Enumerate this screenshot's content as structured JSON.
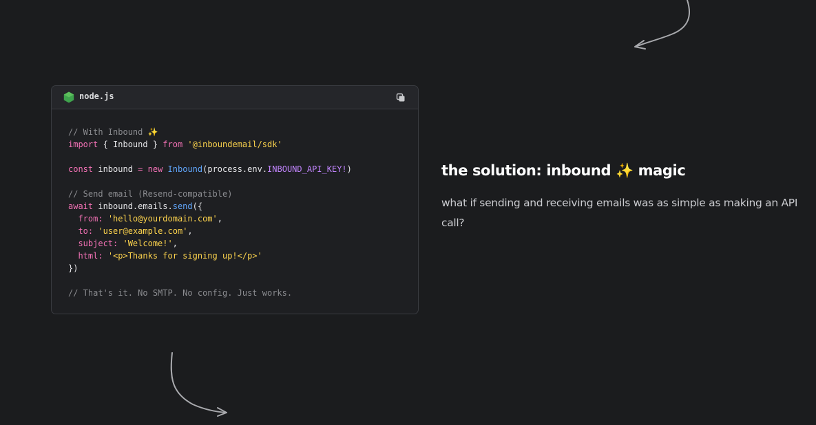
{
  "code_block": {
    "language_label": "node.js",
    "language_icon": "nodejs-hexagon-icon",
    "copy_icon": "copy-icon",
    "lines": [
      [
        {
          "c": "cm",
          "t": "// With Inbound ✨"
        }
      ],
      [
        {
          "c": "kw",
          "t": "import"
        },
        {
          "c": "pl",
          "t": " { Inbound } "
        },
        {
          "c": "kw",
          "t": "from"
        },
        {
          "c": "pl",
          "t": " "
        },
        {
          "c": "st",
          "t": "'@inboundemail/sdk'"
        }
      ],
      [],
      [
        {
          "c": "kw",
          "t": "const"
        },
        {
          "c": "pl",
          "t": " inbound "
        },
        {
          "c": "kw",
          "t": "="
        },
        {
          "c": "pl",
          "t": " "
        },
        {
          "c": "kw",
          "t": "new"
        },
        {
          "c": "pl",
          "t": " "
        },
        {
          "c": "cls",
          "t": "Inbound"
        },
        {
          "c": "pl",
          "t": "(process.env."
        },
        {
          "c": "cn",
          "t": "INBOUND_API_KEY!"
        },
        {
          "c": "pl",
          "t": ")"
        }
      ],
      [],
      [
        {
          "c": "cm",
          "t": "// Send email (Resend-compatible)"
        }
      ],
      [
        {
          "c": "kw",
          "t": "await"
        },
        {
          "c": "pl",
          "t": " inbound.emails."
        },
        {
          "c": "cls",
          "t": "send"
        },
        {
          "c": "pl",
          "t": "({"
        }
      ],
      [
        {
          "c": "pl",
          "t": "  "
        },
        {
          "c": "pr",
          "t": "from:"
        },
        {
          "c": "pl",
          "t": " "
        },
        {
          "c": "st",
          "t": "'hello@yourdomain.com'"
        },
        {
          "c": "pl",
          "t": ","
        }
      ],
      [
        {
          "c": "pl",
          "t": "  "
        },
        {
          "c": "pr",
          "t": "to:"
        },
        {
          "c": "pl",
          "t": " "
        },
        {
          "c": "st",
          "t": "'user@example.com'"
        },
        {
          "c": "pl",
          "t": ","
        }
      ],
      [
        {
          "c": "pl",
          "t": "  "
        },
        {
          "c": "pr",
          "t": "subject:"
        },
        {
          "c": "pl",
          "t": " "
        },
        {
          "c": "st",
          "t": "'Welcome!'"
        },
        {
          "c": "pl",
          "t": ","
        }
      ],
      [
        {
          "c": "pl",
          "t": "  "
        },
        {
          "c": "pr",
          "t": "html:"
        },
        {
          "c": "pl",
          "t": " "
        },
        {
          "c": "st",
          "t": "'<p>Thanks for signing up!</p>'"
        }
      ],
      [
        {
          "c": "pl",
          "t": "})"
        }
      ],
      [],
      [
        {
          "c": "cm",
          "t": "// That's it. No SMTP. No config. Just works."
        }
      ]
    ]
  },
  "solution": {
    "headline": "the solution: inbound ✨ magic",
    "body": "what if sending and receiving emails was as simple as making an API call?"
  },
  "decorations": {
    "top_arrow_icon": "curved-arrow-icon",
    "bottom_arrow_icon": "curved-arrow-icon"
  },
  "colors": {
    "background": "#1b1c1e",
    "keyword": "#f472b6",
    "string": "#fcd34d",
    "comment": "#8b8c90",
    "class": "#60a5fa",
    "constant": "#c084fc",
    "node_green": "#3fa34d"
  }
}
